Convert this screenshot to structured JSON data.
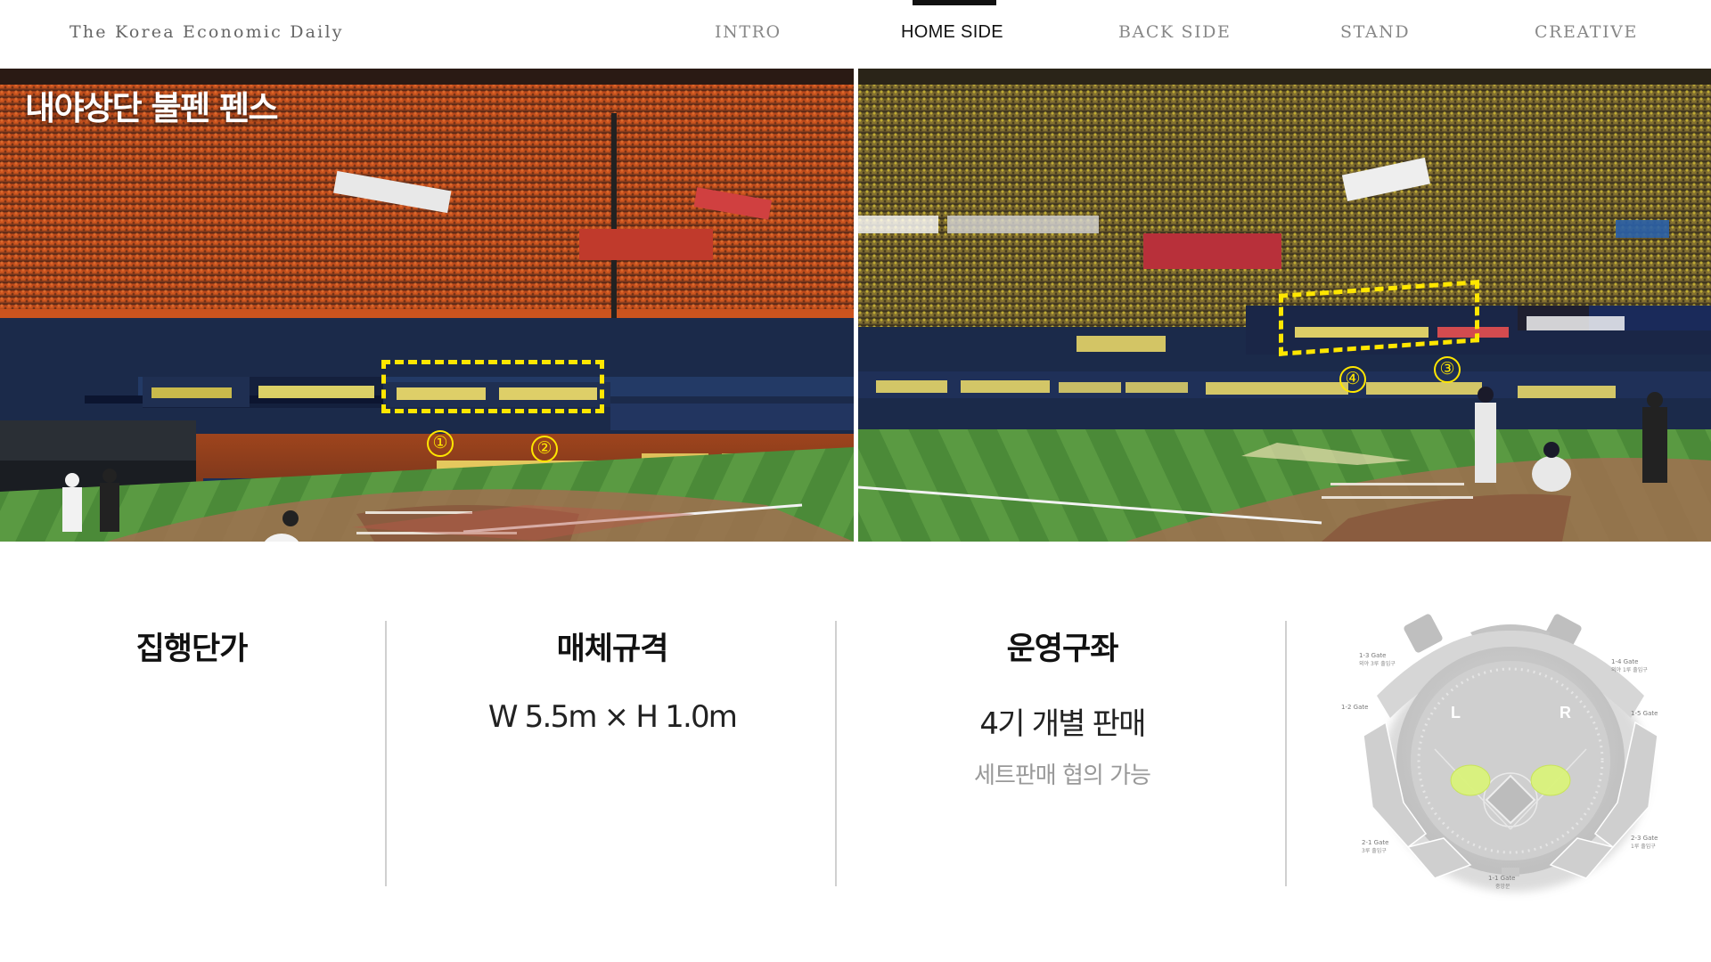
{
  "header": {
    "brand": "The Korea Economic Daily",
    "nav": [
      {
        "label": "INTRO",
        "active": false
      },
      {
        "label": "HOME SIDE",
        "active": true
      },
      {
        "label": "BACK SIDE",
        "active": false
      },
      {
        "label": "STAND",
        "active": false
      },
      {
        "label": "CREATIVE",
        "active": false
      }
    ]
  },
  "photos": {
    "left_title": "내야상단 불펜 펜스",
    "markers": [
      "①",
      "②",
      "④",
      "③"
    ],
    "highlight_color": "#ffe600"
  },
  "info": {
    "price": {
      "heading": "집행단가"
    },
    "spec": {
      "heading": "매체규격",
      "value": "W 5.5m × H 1.0m"
    },
    "operation": {
      "heading": "운영구좌",
      "value": "4기 개별 판매",
      "sub": "세트판매 협의 가능"
    }
  },
  "map": {
    "labels": {
      "gate13": "1-3 Gate",
      "gate13_sub": "외야 3루 출입구",
      "gate14": "1-4 Gate",
      "gate14_sub": "외야 1루 출입구",
      "gate12": "1-2 Gate",
      "gate15": "1-5 Gate",
      "left": "L",
      "right": "R",
      "gate21": "2-1 Gate",
      "gate21_sub": "3루 출입구",
      "gate23": "2-3 Gate",
      "gate23_sub": "1루 출입구",
      "gate11": "1-1 Gate",
      "gate11_sub": "중앙문"
    },
    "highlight_color": "#d9f27a"
  }
}
